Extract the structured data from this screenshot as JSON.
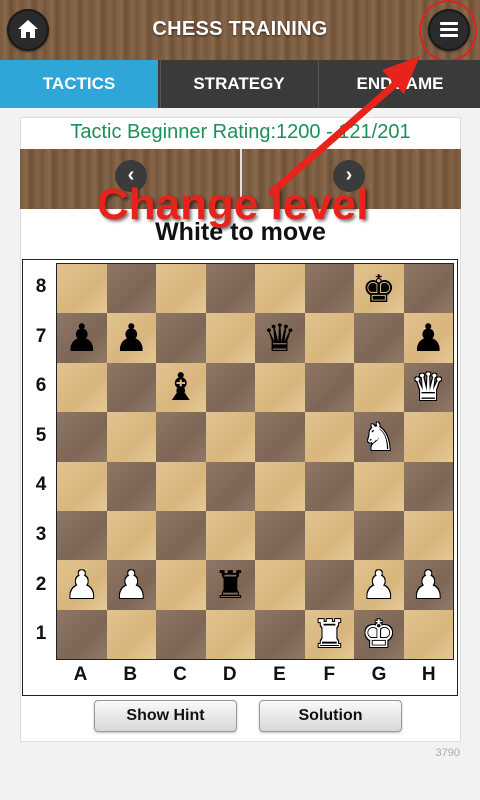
{
  "header": {
    "title": "CHESS TRAINING",
    "home_icon": "home-icon",
    "menu_icon": "hamburger-menu-icon"
  },
  "tabs": [
    {
      "label": "TACTICS",
      "active": true
    },
    {
      "label": "STRATEGY",
      "active": false
    },
    {
      "label": "ENDGAME",
      "active": false
    }
  ],
  "puzzle": {
    "rating_text": "Tactic Beginner Rating:1200 - 121/201",
    "to_move": "White to move",
    "id": "3790"
  },
  "nav": {
    "prev_glyph": "‹",
    "next_glyph": "›"
  },
  "annotation": {
    "text": "Change level",
    "color": "#e8231b"
  },
  "board": {
    "ranks": [
      "8",
      "7",
      "6",
      "5",
      "4",
      "3",
      "2",
      "1"
    ],
    "files": [
      "A",
      "B",
      "C",
      "D",
      "E",
      "F",
      "G",
      "H"
    ],
    "rows": [
      [
        "",
        "",
        "",
        "",
        "",
        "",
        "bK",
        ""
      ],
      [
        "bP",
        "bP",
        "",
        "",
        "bQ",
        "",
        "",
        "bP"
      ],
      [
        "",
        "",
        "bB",
        "",
        "",
        "",
        "",
        "wQ"
      ],
      [
        "",
        "",
        "",
        "",
        "",
        "",
        "wN",
        ""
      ],
      [
        "",
        "",
        "",
        "",
        "",
        "",
        "",
        ""
      ],
      [
        "",
        "",
        "",
        "",
        "",
        "",
        "",
        ""
      ],
      [
        "wP",
        "wP",
        "",
        "bR",
        "",
        "",
        "wP",
        "wP"
      ],
      [
        "",
        "",
        "",
        "",
        "",
        "wR",
        "wK",
        ""
      ]
    ]
  },
  "buttons": {
    "hint": "Show Hint",
    "solution": "Solution"
  },
  "colors": {
    "tab_active": "#2fa5d8",
    "rating_text": "#1c8f5a",
    "light_square": "#e2c38f",
    "dark_square": "#8f7766"
  }
}
